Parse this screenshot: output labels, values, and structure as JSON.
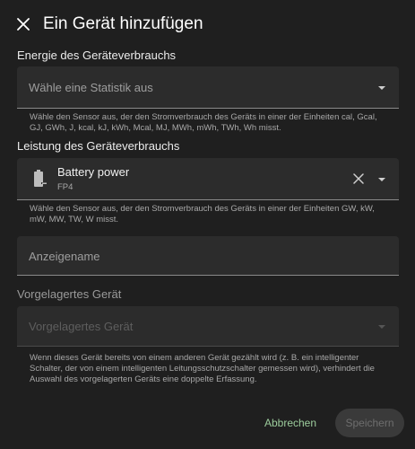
{
  "dialog": {
    "title": "Ein Gerät hinzufügen",
    "close_icon": "close-icon"
  },
  "energy": {
    "label": "Energie des Geräteverbrauchs",
    "placeholder": "Wähle eine Statistik aus",
    "helper": "Wähle den Sensor aus, der den Stromverbrauch des Geräts in einer der Einheiten cal, Gcal, GJ, GWh, J, kcal, kJ, kWh, Mcal, MJ, MWh, mWh, TWh, Wh misst."
  },
  "power": {
    "label": "Leistung des Geräteverbrauchs",
    "selected_name": "Battery power",
    "selected_sub": "FP4",
    "icon": "battery-icon",
    "helper": "Wähle den Sensor aus, der den Stromverbrauch des Geräts in einer der Einheiten GW, kW, mW, MW, TW, W misst."
  },
  "display_name": {
    "placeholder": "Anzeigename"
  },
  "upstream": {
    "label": "Vorgelagertes Gerät",
    "placeholder": "Vorgelagertes Gerät",
    "helper": "Wenn dieses Gerät bereits von einem anderen Gerät gezählt wird (z. B. ein intelligenter Schalter, der von einem intelligenten Leitungsschutzschalter gemessen wird), verhindert die Auswahl des vorgelagerten Geräts eine doppelte Erfassung."
  },
  "actions": {
    "cancel": "Abbrechen",
    "save": "Speichern"
  },
  "colors": {
    "background": "#1f1f1f",
    "field": "#2c2c2c",
    "accent_cancel": "#9ccc9c"
  }
}
